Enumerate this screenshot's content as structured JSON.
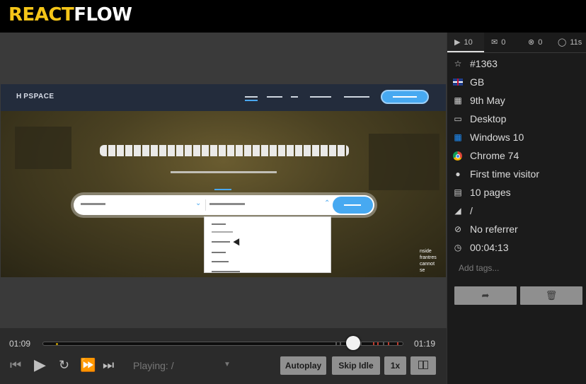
{
  "header": {
    "logo_part1": "REACT",
    "logo_part2": "FLOW"
  },
  "embedded_page": {
    "logo": "H PSPACE",
    "side_text": [
      "nside",
      "frantres",
      "cannot",
      "se"
    ]
  },
  "timeline": {
    "current_time": "01:09",
    "total_time": "01:19",
    "progress": 0.86
  },
  "player": {
    "playing_label": "Playing: /",
    "autoplay_label": "Autoplay",
    "skip_idle_label": "Skip Idle",
    "speed_label": "1x"
  },
  "tabs": [
    {
      "icon": "video-camera-icon",
      "label": "10"
    },
    {
      "icon": "comment-icon",
      "label": "0"
    },
    {
      "icon": "error-icon",
      "label": "0"
    },
    {
      "icon": "speedometer-icon",
      "label": "11s"
    }
  ],
  "details": [
    {
      "icon": "star-icon",
      "text": "#1363"
    },
    {
      "icon": "flag-gb-icon",
      "text": "GB"
    },
    {
      "icon": "calendar-icon",
      "text": "9th May"
    },
    {
      "icon": "monitor-icon",
      "text": "Desktop"
    },
    {
      "icon": "windows-icon",
      "text": "Windows 10"
    },
    {
      "icon": "chrome-icon",
      "text": "Chrome 74"
    },
    {
      "icon": "user-icon",
      "text": "First time visitor"
    },
    {
      "icon": "file-icon",
      "text": "10 pages"
    },
    {
      "icon": "image-icon",
      "text": "/"
    },
    {
      "icon": "ban-icon",
      "text": "No referrer"
    },
    {
      "icon": "clock-icon",
      "text": "00:04:13"
    }
  ],
  "tags_placeholder": "Add tags...",
  "colors": {
    "logo_accent": "#f5c518",
    "site_blue": "#47a9f1",
    "panel_bg": "#1b1b1b"
  }
}
